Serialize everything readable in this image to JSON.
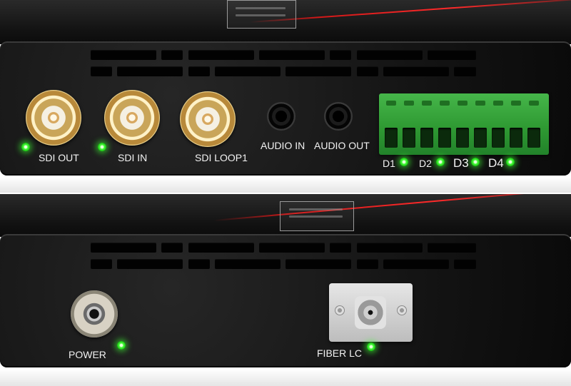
{
  "top_unit": {
    "ports": {
      "sdi_out": "SDI OUT",
      "sdi_in": "SDI IN",
      "sdi_loop1": "SDI LOOP1",
      "audio_in": "AUDIO IN",
      "audio_out": "AUDIO OUT"
    },
    "data_labels": [
      "D1",
      "D2",
      "D3",
      "D4"
    ]
  },
  "bottom_unit": {
    "ports": {
      "power": "POWER",
      "fiber_lc": "FIBER LC"
    }
  },
  "colors": {
    "led": "#3cff32",
    "terminal_block": "#37a83b",
    "chassis": "#141414",
    "accent_stripe": "#e01c1c"
  }
}
